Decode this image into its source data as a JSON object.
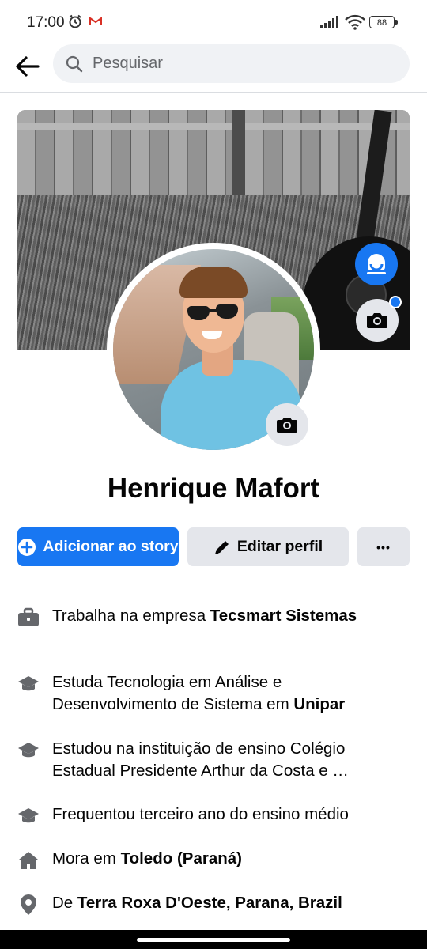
{
  "status_bar": {
    "time": "17:00",
    "battery": "88"
  },
  "search": {
    "placeholder": "Pesquisar"
  },
  "profile": {
    "name": "Henrique Mafort"
  },
  "actions": {
    "add_story_label": "Adicionar ao story",
    "edit_profile_label": "Editar perfil",
    "more_label": "•••"
  },
  "details": [
    {
      "icon": "briefcase-icon",
      "prefix": "Trabalha na empresa ",
      "bold": "Tecsmart Sistemas",
      "suffix": ""
    },
    {
      "icon": "graduation-cap-icon",
      "prefix": "Estuda Tecnologia em Análise e Desenvolvimento de Sistema em ",
      "bold": "Unipar",
      "suffix": ""
    },
    {
      "icon": "graduation-cap-icon",
      "prefix": "Estudou na instituição de ensino Colégio Estadual Presidente Arthur da Costa e …",
      "bold": "",
      "suffix": ""
    },
    {
      "icon": "graduation-cap-icon",
      "prefix": "Frequentou terceiro ano do ensino médio",
      "bold": "",
      "suffix": ""
    },
    {
      "icon": "home-icon",
      "prefix": "Mora em ",
      "bold": "Toledo (Paraná)",
      "suffix": ""
    },
    {
      "icon": "location-pin-icon",
      "prefix": "De ",
      "bold": "Terra Roxa D'Oeste, Parana, Brazil",
      "suffix": ""
    }
  ],
  "colors": {
    "accent": "#1877f2",
    "button_gray": "#e4e6eb",
    "icon_gray": "#65676b"
  }
}
